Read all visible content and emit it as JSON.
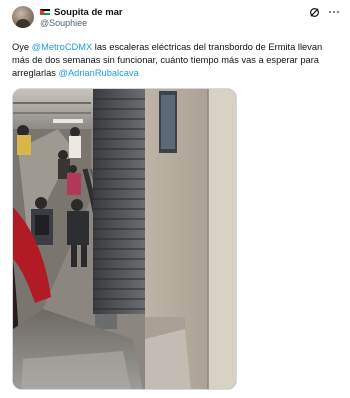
{
  "author": {
    "display_name": "Soupita de mar",
    "handle": "@Souphiee",
    "flag": "palestine-flag"
  },
  "actions": {
    "grok_icon": "grok-icon",
    "more_icon": "more-horizontal-icon"
  },
  "tweet": {
    "segments": [
      {
        "text": "Oye ",
        "type": "text"
      },
      {
        "text": "@MetroCDMX",
        "type": "mention"
      },
      {
        "text": " las escaleras eléctricas del transbordo de Ermita llevan más de dos semanas sin funcionar, cuánto tiempo más vas a esperar para arreglarlas ",
        "type": "text"
      },
      {
        "text": "@AdrianRubalcava",
        "type": "mention"
      }
    ]
  },
  "media": {
    "kind": "photo",
    "subject": "escalator-station-photo"
  },
  "colors": {
    "mention": "#1d9bf0",
    "handle": "#536471",
    "text": "#0f1419"
  }
}
